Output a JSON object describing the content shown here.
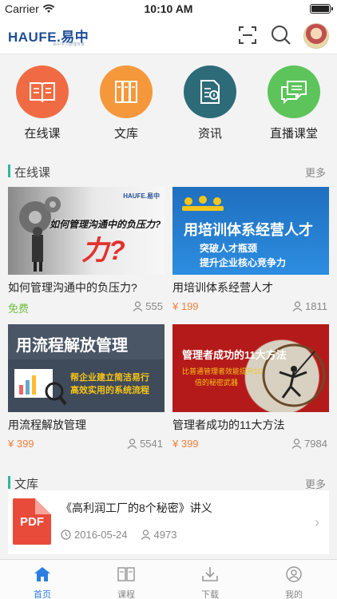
{
  "status": {
    "carrier": "Carrier",
    "time": "10:10 AM"
  },
  "header": {
    "logo_text_left": "HAUFE.",
    "logo_text_right": "易中",
    "logo_sub": "易中学习管理专家"
  },
  "categories": [
    {
      "label": "在线课",
      "color": "#f06b44",
      "icon": "book-icon"
    },
    {
      "label": "文库",
      "color": "#f5983b",
      "icon": "library-icon"
    },
    {
      "label": "资讯",
      "color": "#2e6b78",
      "icon": "news-icon"
    },
    {
      "label": "直播课堂",
      "color": "#5cc45a",
      "icon": "live-chat-icon"
    }
  ],
  "online_section": {
    "title": "在线课",
    "more": "更多"
  },
  "courses": [
    {
      "title": "如何管理沟通中的负压力?",
      "price": "免费",
      "count": "555",
      "thumb_text": "如何管理沟通中的负压力?",
      "thumb_brand": "HAUFE.易中"
    },
    {
      "title": "用培训体系经营人才",
      "price": "¥ 199",
      "count": "1811",
      "thumb_text": "用培训体系经营人才",
      "thumb_sub1": "突破人才瓶颈",
      "thumb_sub2": "提升企业核心竞争力"
    },
    {
      "title": "用流程解放管理",
      "price": "¥ 399",
      "count": "5541",
      "thumb_text": "用流程解放管理",
      "thumb_sub1": "帮企业建立简洁易行",
      "thumb_sub2": "高效实用的系统流程"
    },
    {
      "title": "管理者成功的11大方法",
      "price": "¥ 399",
      "count": "7984",
      "thumb_text": "管理者成功的11大方法",
      "thumb_sub1": "比普通管理者效能提升10",
      "thumb_sub2": "倍的秘密武器"
    }
  ],
  "library_section": {
    "title": "文库",
    "more": "更多"
  },
  "document": {
    "badge": "PDF",
    "title": "《高利润工厂的8个秘密》讲义",
    "date": "2016-05-24",
    "count": "4973"
  },
  "tabs": [
    {
      "label": "首页",
      "icon": "home-icon",
      "active": true
    },
    {
      "label": "课程",
      "icon": "course-icon",
      "active": false
    },
    {
      "label": "下载",
      "icon": "download-icon",
      "active": false
    },
    {
      "label": "我的",
      "icon": "profile-icon",
      "active": false
    }
  ],
  "colors": {
    "accent": "#2a7de1",
    "section_bar": "#2fb7a0",
    "price": "#f0803c",
    "free": "#6cbd3c"
  }
}
